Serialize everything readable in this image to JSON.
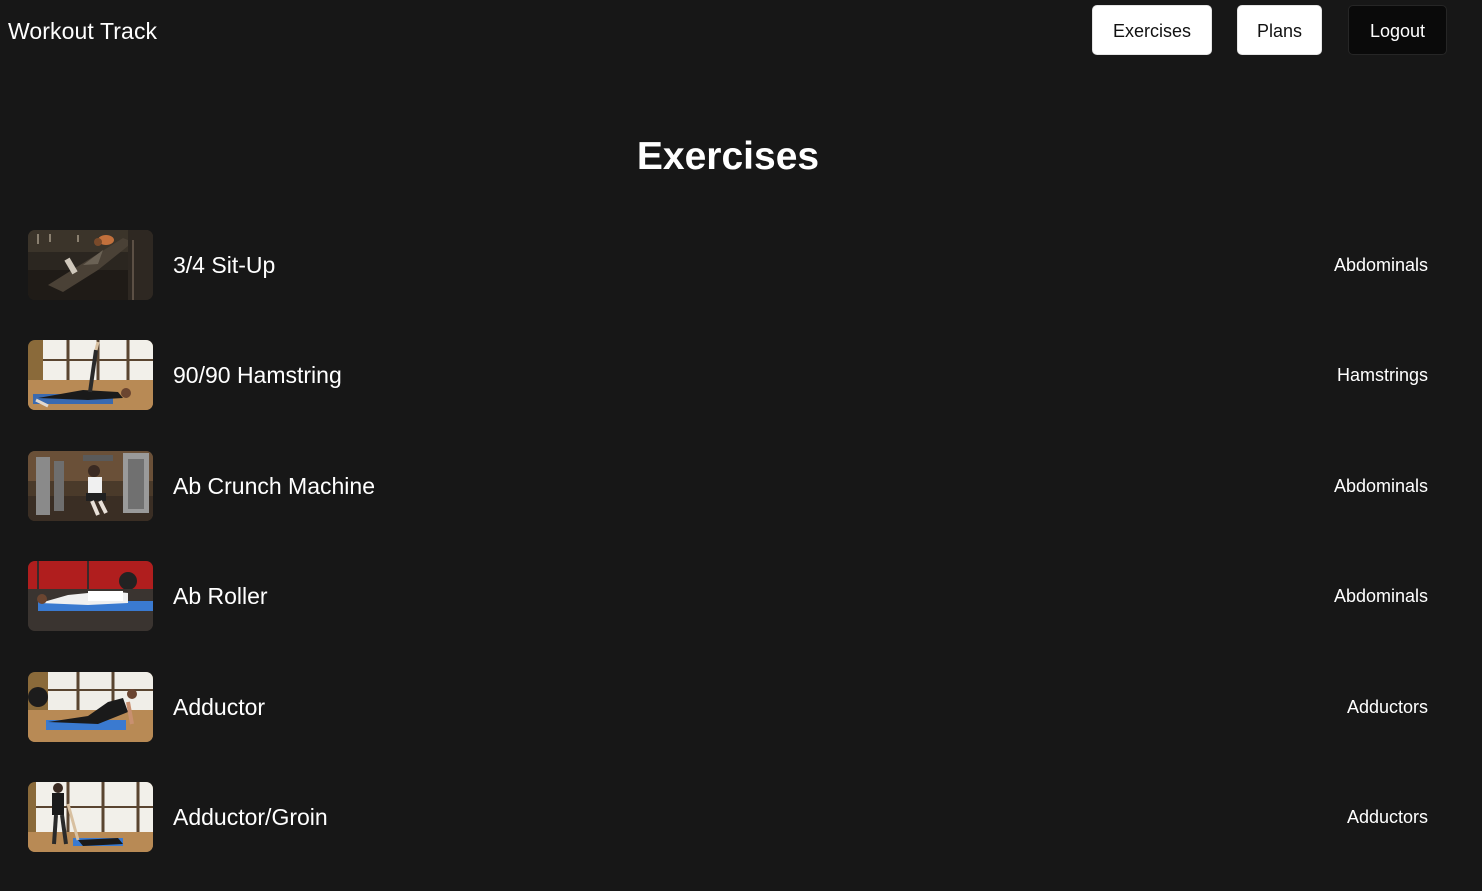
{
  "app": {
    "brand": "Workout Track"
  },
  "nav": {
    "exercises_label": "Exercises",
    "plans_label": "Plans",
    "logout_label": "Logout"
  },
  "page": {
    "title": "Exercises"
  },
  "exercises": [
    {
      "name": "3/4 Sit-Up",
      "muscle": "Abdominals",
      "thumbnail": "gym-sit-up-photo"
    },
    {
      "name": "90/90 Hamstring",
      "muscle": "Hamstrings",
      "thumbnail": "floor-stretch-window-photo"
    },
    {
      "name": "Ab Crunch Machine",
      "muscle": "Abdominals",
      "thumbnail": "gym-machine-photo"
    },
    {
      "name": "Ab Roller",
      "muscle": "Abdominals",
      "thumbnail": "red-wall-mat-photo"
    },
    {
      "name": "Adductor",
      "muscle": "Adductors",
      "thumbnail": "floor-mat-window-photo"
    },
    {
      "name": "Adductor/Groin",
      "muscle": "Adductors",
      "thumbnail": "partner-stretch-window-photo"
    }
  ],
  "colors": {
    "background": "#171717",
    "text": "#ffffff",
    "button_light": "#ffffff",
    "button_dark": "#0a0a0a"
  }
}
